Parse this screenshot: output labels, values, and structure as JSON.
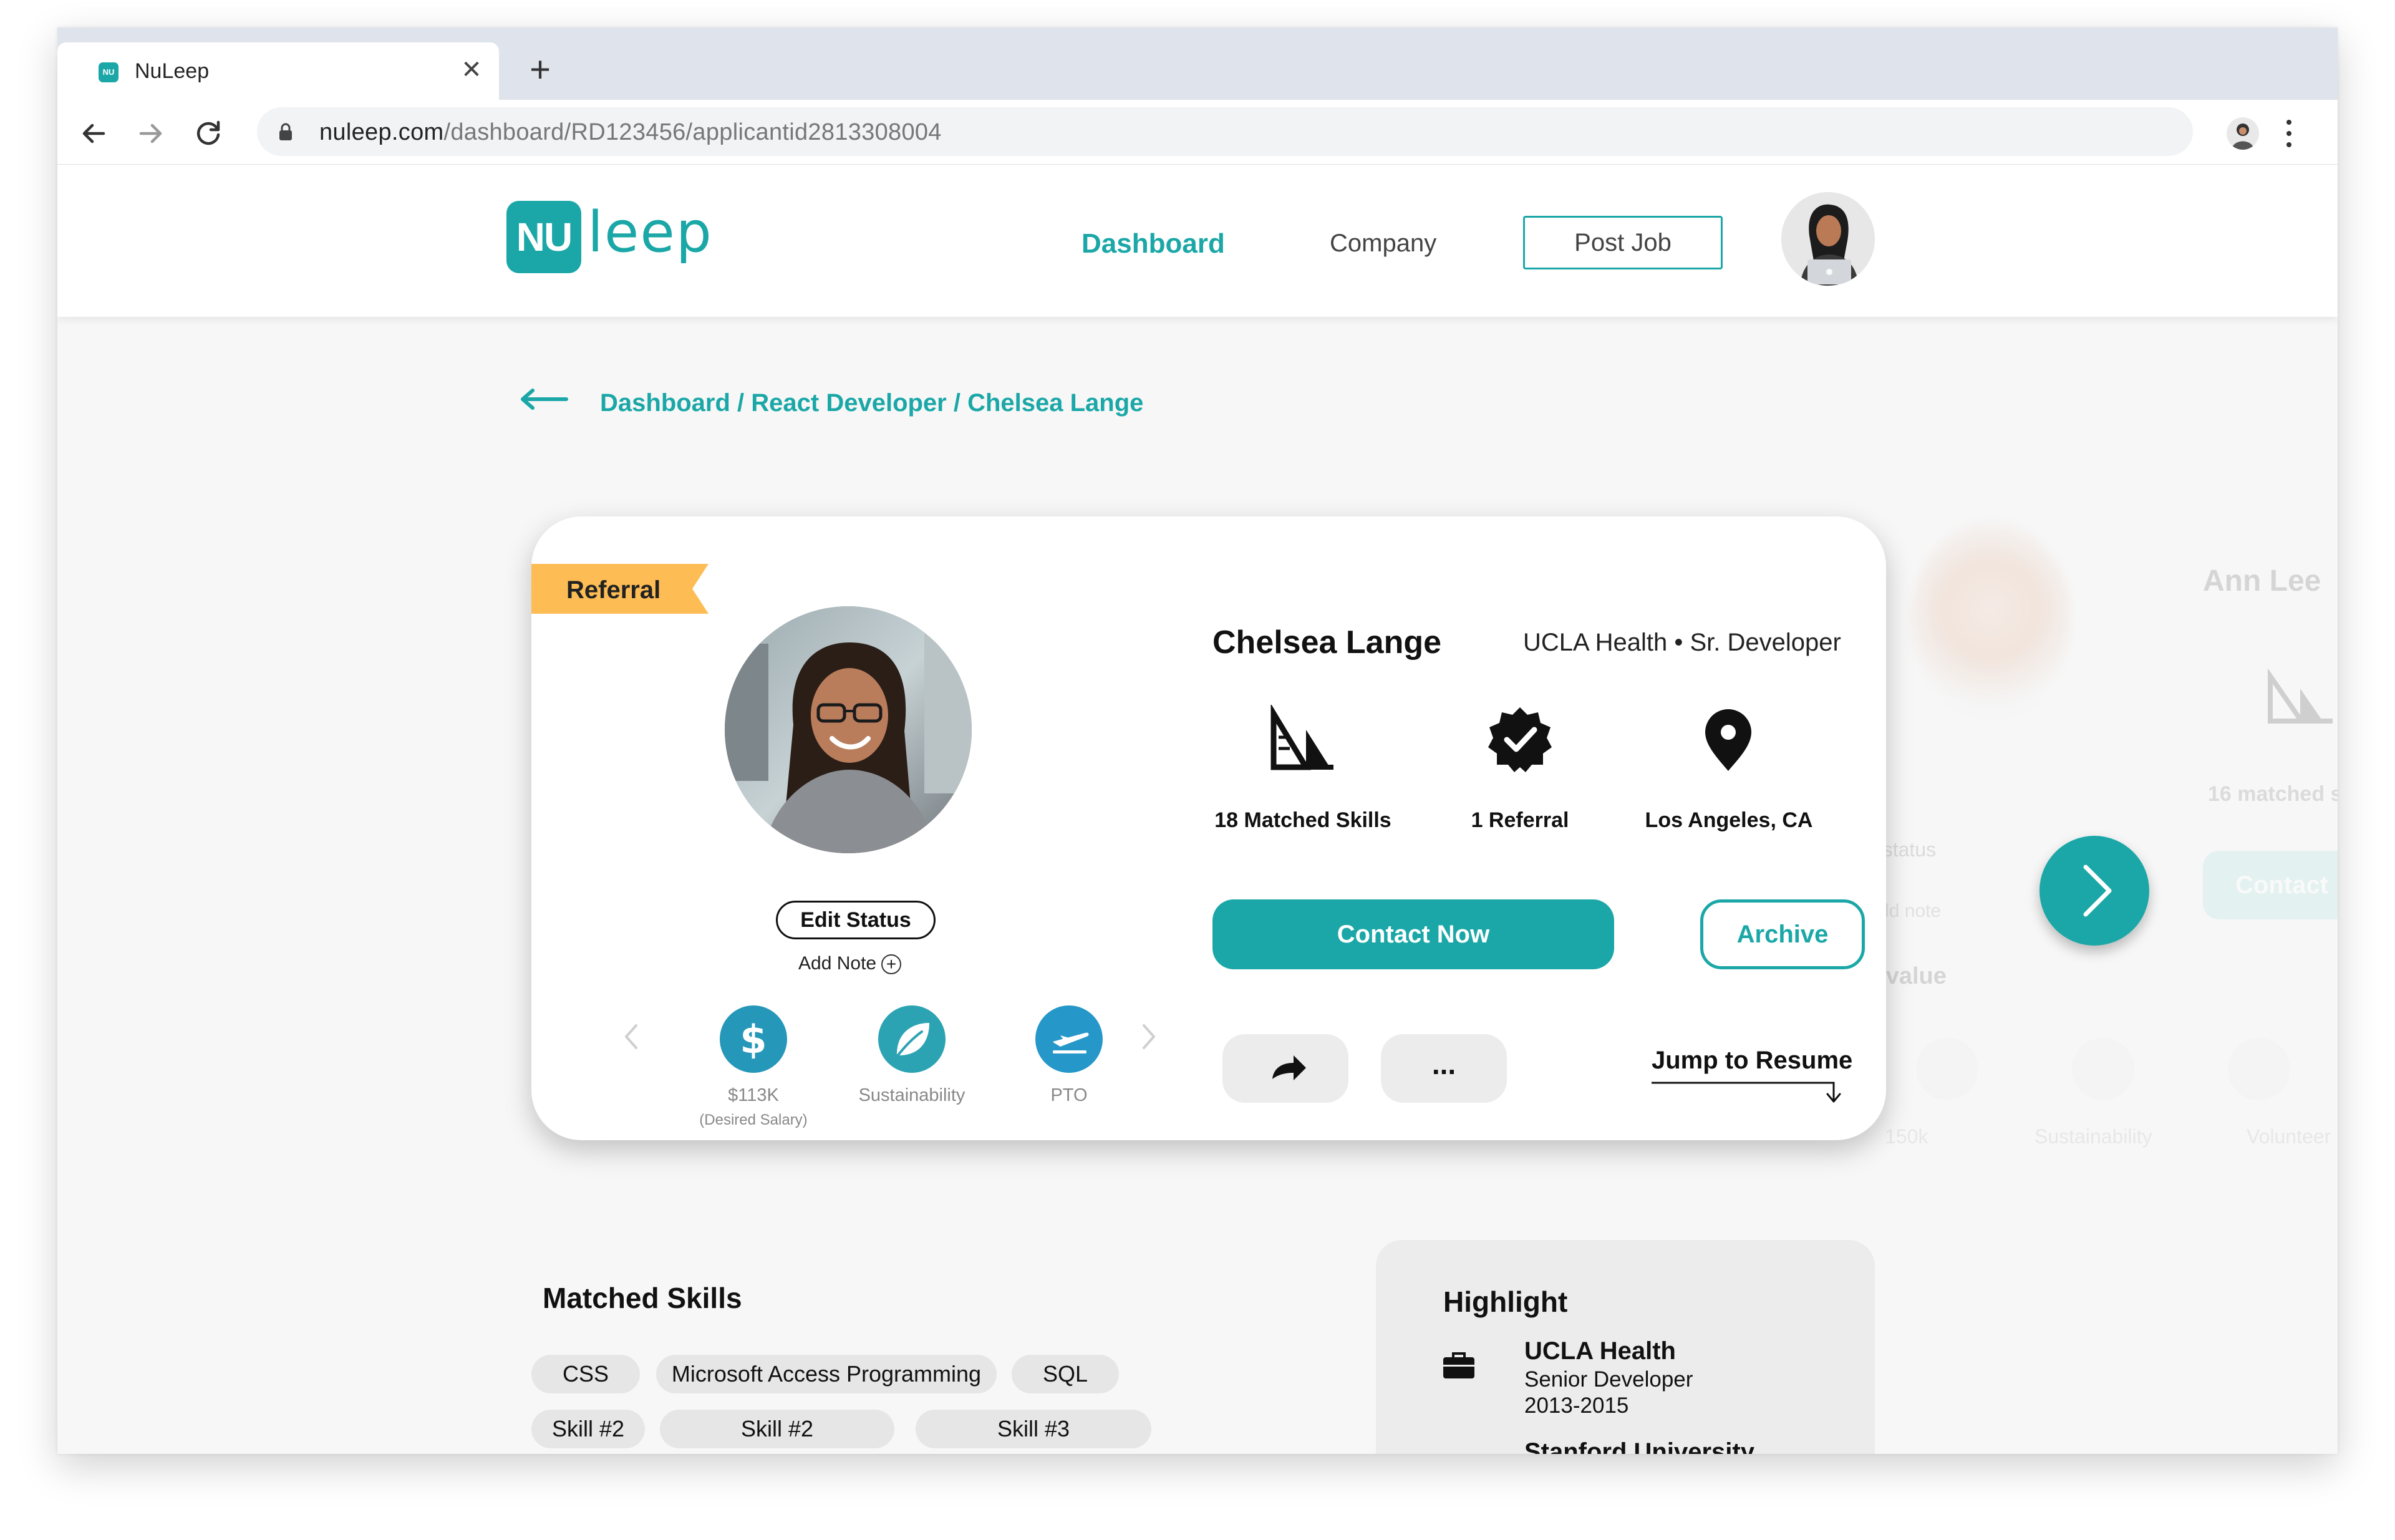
{
  "browser": {
    "tab_title": "NuLeep",
    "favicon_text": "NU",
    "url_host": "nuleep.com",
    "url_path": "/dashboard/RD123456/applicantid2813308004"
  },
  "header": {
    "logo_mark": "NU",
    "logo_text": "leep",
    "nav_dashboard": "Dashboard",
    "nav_company": "Company",
    "post_job": "Post Job"
  },
  "breadcrumb": "Dashboard / React Developer / Chelsea Lange",
  "card": {
    "ribbon": "Referral",
    "name": "Chelsea Lange",
    "role": "UCLA Health • Sr. Developer",
    "stats": [
      {
        "label": "18 Matched Skills",
        "icon": "skills-icon"
      },
      {
        "label": "1 Referral",
        "icon": "verified-badge-icon"
      },
      {
        "label": "Los Angeles, CA",
        "icon": "location-pin-icon"
      }
    ],
    "edit_status": "Edit Status",
    "add_note": "Add Note",
    "perks": [
      {
        "label": "$113K",
        "sub": "(Desired Salary)",
        "icon": "dollar-icon",
        "color": "#2597b8"
      },
      {
        "label": "Sustainability",
        "sub": "",
        "icon": "leaf-icon",
        "color": "#2ba3b3"
      },
      {
        "label": "PTO",
        "sub": "",
        "icon": "plane-icon",
        "color": "#2597c8"
      }
    ],
    "contact": "Contact Now",
    "archive": "Archive",
    "more": "...",
    "jump": "Jump to Resume"
  },
  "ghost_card": {
    "name": "Ann Lee",
    "matched": "16 matched s",
    "status": "d status",
    "note": "Add note",
    "value": "s value",
    "contact": "Contact",
    "labels": [
      "150k",
      "Sustainability",
      "Volunteer"
    ]
  },
  "matched_skills": {
    "title": "Matched Skills",
    "chips_row1": [
      "CSS",
      "Microsoft Access Programming",
      "SQL"
    ],
    "chips_row2": [
      "Skill #2",
      "Skill #2",
      "Skill #3"
    ]
  },
  "highlight": {
    "title": "Highlight",
    "org": "UCLA Health",
    "position": "Senior Developer",
    "years": "2013-2015",
    "org2": "Stanford University"
  },
  "colors": {
    "accent": "#1ba7a7",
    "ribbon": "#fdbd54"
  }
}
